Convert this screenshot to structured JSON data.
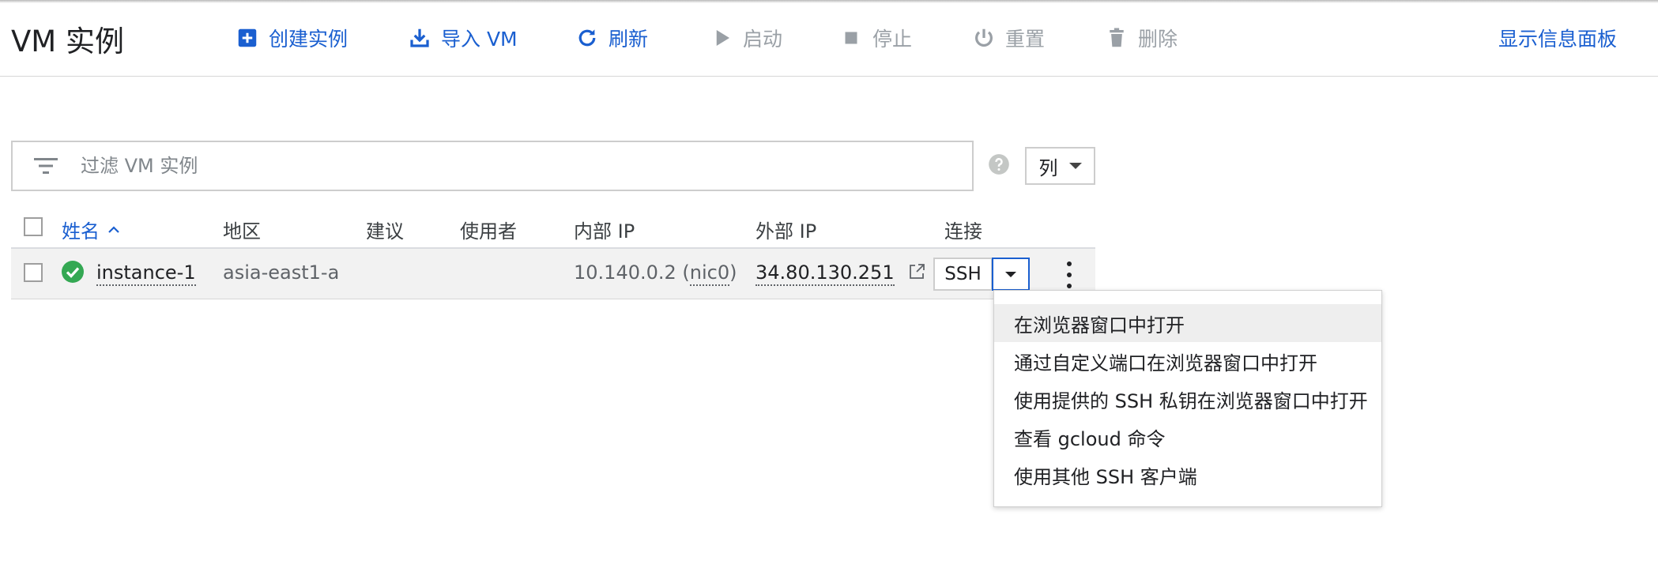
{
  "page": {
    "title": "VM 实例",
    "info_panel_link": "显示信息面板"
  },
  "toolbar": {
    "create": "创建实例",
    "import": "导入 VM",
    "refresh": "刷新",
    "start": "启动",
    "stop": "停止",
    "reset": "重置",
    "delete": "删除"
  },
  "filter": {
    "placeholder": "过滤 VM 实例",
    "columns_label": "列"
  },
  "table": {
    "headers": {
      "name": "姓名",
      "zone": "地区",
      "recommendation": "建议",
      "in_use_by": "使用者",
      "internal_ip": "内部 IP",
      "external_ip": "外部 IP",
      "connect": "连接"
    },
    "rows": [
      {
        "name": "instance-1",
        "zone": "asia-east1-a",
        "recommendation": "",
        "in_use_by": "",
        "internal_ip_prefix": "10.140.0.2 (",
        "internal_ip_nic": "nic0",
        "internal_ip_suffix": ")",
        "external_ip": "34.80.130.251",
        "connect_label": "SSH",
        "status": "running"
      }
    ]
  },
  "ssh_menu": {
    "items": [
      "在浏览器窗口中打开",
      "通过自定义端口在浏览器窗口中打开",
      "使用提供的 SSH 私钥在浏览器窗口中打开",
      "查看 gcloud 命令",
      "使用其他 SSH 客户端"
    ]
  },
  "colors": {
    "accent": "#1a5fd0",
    "disabled": "#9aa0a6",
    "success": "#34a853"
  }
}
